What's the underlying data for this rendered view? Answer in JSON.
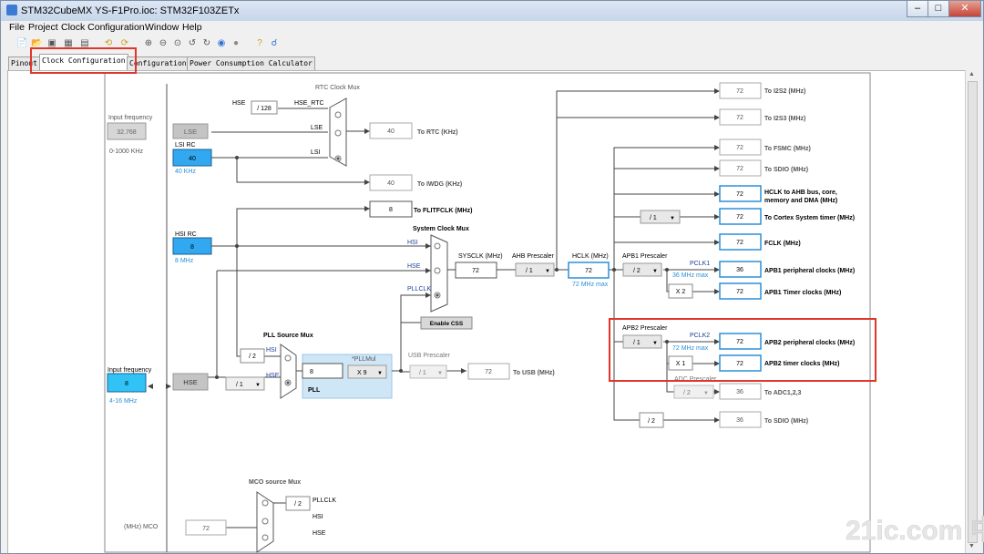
{
  "window": {
    "title": "STM32CubeMX YS-F1Pro.ioc: STM32F103ZETx",
    "controls": {
      "minimize": "–",
      "maximize": "□",
      "close": "✕"
    }
  },
  "menu": [
    "File",
    "Project",
    "Clock Configuration",
    "Window",
    "Help"
  ],
  "tabs": [
    "Pinout",
    "Clock Configuration",
    "Configuration",
    "Power Consumption Calculator"
  ],
  "active_tab": "Clock Configuration",
  "toolbar_icons": [
    "new-project-icon",
    "open-project-icon",
    "save-icon",
    "save-as-icon",
    "export-icon",
    "undo-icon",
    "redo-icon",
    "zoom-in-icon",
    "zoom-out-icon",
    "zoom-fit-icon",
    "rotate-left-icon",
    "rotate-right-icon",
    "refresh-icon",
    "stop-icon",
    "help-icon",
    "search-icon"
  ],
  "lse": {
    "input_label": "Input frequency",
    "input_value": "32.768",
    "range": "0-1000 KHz",
    "name": "LSE"
  },
  "lsi": {
    "title": "LSI RC",
    "value": "40",
    "freq": "40 KHz"
  },
  "hsi": {
    "title": "HSI RC",
    "value": "8",
    "freq": "8 MHz"
  },
  "hse": {
    "input_label": "Input frequency",
    "input_value": "8",
    "range": "4-16 MHz",
    "name": "HSE",
    "div": "/ 1"
  },
  "rtc": {
    "mux_title": "RTC Clock Mux",
    "hse_label": "HSE",
    "div": "/ 128",
    "hse_rtc": "HSE_RTC",
    "lse": "LSE",
    "lsi": "LSI",
    "value": "40",
    "dest": "To RTC (KHz)"
  },
  "iwdg": {
    "value": "40",
    "dest": "To IWDG (KHz)"
  },
  "flitf": {
    "value": "8",
    "dest": "To FLITFCLK (MHz)"
  },
  "sysmux": {
    "title": "System Clock Mux",
    "hsi": "HSI",
    "hse": "HSE",
    "pllclk": "PLLCLK",
    "css": "Enable CSS"
  },
  "sysclk": {
    "label": "SYSCLK (MHz)",
    "value": "72"
  },
  "ahb": {
    "label": "AHB Prescaler",
    "value": "/ 1"
  },
  "hclk": {
    "label": "HCLK (MHz)",
    "value": "72",
    "max": "72 MHz max"
  },
  "apb1": {
    "label": "APB1 Prescaler",
    "value": "/ 2",
    "pclk": "PCLK1",
    "max": "36 MHz max",
    "mult": "X 2"
  },
  "apb2": {
    "label": "APB2 Prescaler",
    "value": "/ 1",
    "pclk": "PCLK2",
    "max": "72 MHz max",
    "mult": "X 1"
  },
  "adc": {
    "label": "ADC Prescaler",
    "value": "/ 2"
  },
  "cortex_div": "/ 1",
  "sdio_div": "/ 2",
  "pllmux": {
    "title": "PLL Source Mux",
    "div": "/ 2",
    "hsi": "HSI",
    "hse": "HSE"
  },
  "pll": {
    "mul_label": "*PLLMul",
    "in_value": "8",
    "mul": "X 9",
    "name": "PLL"
  },
  "usb": {
    "label": "USB Prescaler",
    "value": "/ 1",
    "out": "72",
    "dest": "To USB (MHz)"
  },
  "outputs": {
    "i2s2": {
      "value": "72",
      "label": "To I2S2 (MHz)"
    },
    "i2s3": {
      "value": "72",
      "label": "To I2S3 (MHz)"
    },
    "fsmc": {
      "value": "72",
      "label": "To FSMC (MHz)"
    },
    "sdio1": {
      "value": "72",
      "label": "To SDIO (MHz)"
    },
    "hclk_ahb": {
      "value": "72",
      "label1": "HCLK to AHB bus, core,",
      "label2": "memory and DMA (MHz)"
    },
    "cortex": {
      "value": "72",
      "label": "To Cortex System timer (MHz)"
    },
    "fclk": {
      "value": "72",
      "label": "FCLK (MHz)"
    },
    "apb1_periph": {
      "value": "36",
      "label": "APB1 peripheral clocks (MHz)"
    },
    "apb1_timer": {
      "value": "72",
      "label": "APB1 Timer clocks (MHz)"
    },
    "apb2_periph": {
      "value": "72",
      "label": "APB2 peripheral clocks (MHz)"
    },
    "apb2_timer": {
      "value": "72",
      "label": "APB2 timer clocks (MHz)"
    },
    "adc": {
      "value": "36",
      "label": "To ADC1,2,3"
    },
    "sdio2": {
      "value": "36",
      "label": "To SDIO (MHz)"
    }
  },
  "mco": {
    "title": "MCO source Mux",
    "label": "(MHz) MCO",
    "value": "72",
    "div": "/ 2",
    "pllclk": "PLLCLK",
    "hsi": "HSI",
    "hse": "HSE"
  },
  "watermark": "21ic.com 中国电子网"
}
